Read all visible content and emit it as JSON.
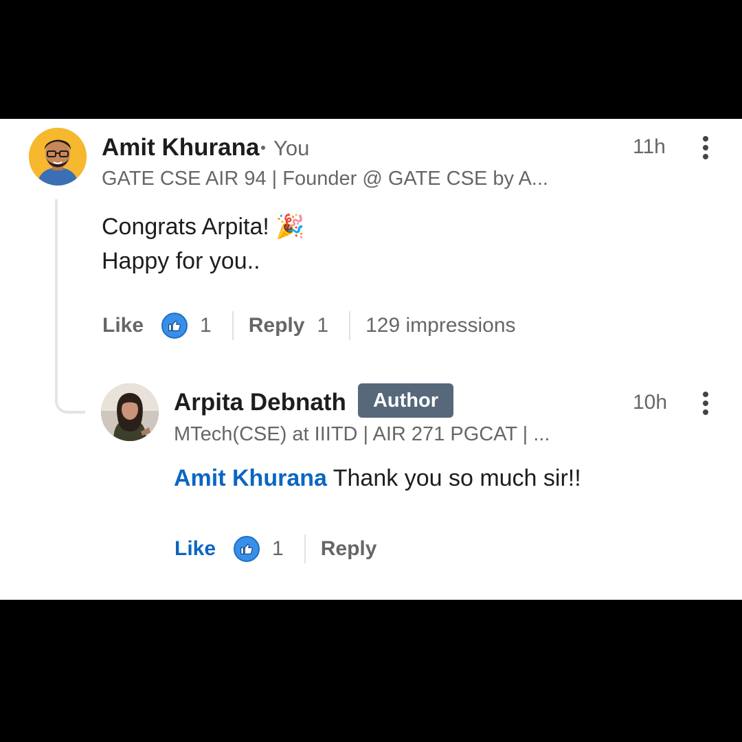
{
  "comment": {
    "author_name": "Amit Khurana",
    "you_label": "You",
    "headline": "GATE CSE AIR 94 | Founder @ GATE CSE by A...",
    "time": "11h",
    "text_line1": "Congrats Arpita! 🎉",
    "text_line2": "Happy for you..",
    "like_label": "Like",
    "like_count": "1",
    "reply_label": "Reply",
    "reply_count": "1",
    "impressions": "129 impressions"
  },
  "reply": {
    "author_name": "Arpita Debnath",
    "badge": "Author",
    "headline": "MTech(CSE) at IIITD | AIR 271 PGCAT | ...",
    "time": "10h",
    "mention": "Amit Khurana",
    "text": " Thank you so much sir!!",
    "like_label": "Like",
    "like_count": "1",
    "reply_label": "Reply"
  },
  "icons": {
    "reaction": "thumbs-up-icon",
    "menu": "more-vertical-icon"
  },
  "colors": {
    "link_blue": "#0a66c2",
    "reaction_blue": "#378fe9",
    "author_badge": "#56687a"
  }
}
